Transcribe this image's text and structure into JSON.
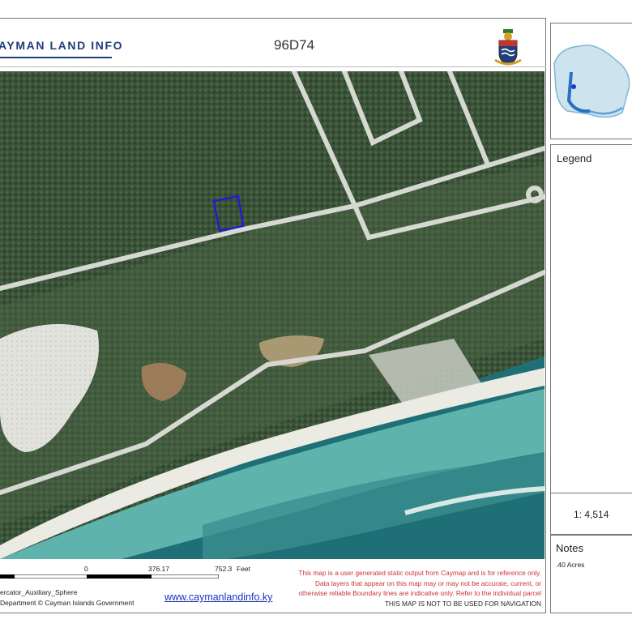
{
  "header": {
    "logo_text": "AYMAN LAND INFO",
    "title": "96D74"
  },
  "map": {
    "parcel_outline_color": "#1a1adf",
    "features": [
      "forest",
      "roads",
      "parcel-outline",
      "beach",
      "reef",
      "sea"
    ]
  },
  "footer": {
    "scale_ticks": [
      "0",
      "376.17",
      "752.3"
    ],
    "scale_units": "Feet",
    "projection": "ercator_Auxiliary_Sphere",
    "copyright": "Department © Cayman Islands Government",
    "website": "www.caymanlandinfo.ky",
    "disclaimer_lines": [
      "This map is a user generated static output from Caymap and is for reference only.",
      "Data layers that appear on this map may or may not be accurate, current, or",
      "otherwise reliable.Boundary lines are indicative only. Refer to the individual parcel"
    ],
    "nav_warning": "THIS MAP IS NOT TO BE USED FOR NAVIGATION"
  },
  "sidebar": {
    "legend_title": "Legend",
    "scale": "1: 4,514",
    "notes_title": "Notes",
    "notes_text": ".40 Acres"
  },
  "colors": {
    "brand": "#1f3e7a",
    "link": "#1a34b8",
    "disclaimer": "#cc3333"
  }
}
